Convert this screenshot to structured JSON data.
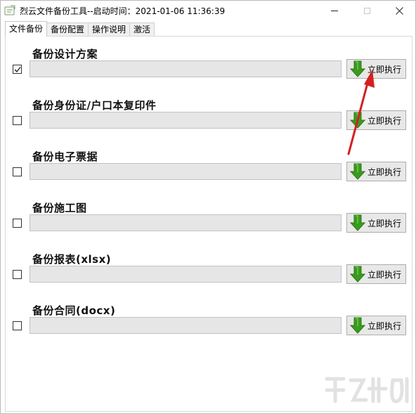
{
  "window": {
    "title": "烈云文件备份工具--启动时间：2021-01-06 11:36:39"
  },
  "tabs": [
    {
      "label": "文件备份",
      "active": true
    },
    {
      "label": "备份配置",
      "active": false
    },
    {
      "label": "操作说明",
      "active": false
    },
    {
      "label": "激活",
      "active": false
    }
  ],
  "rows": [
    {
      "title": "备份设计方案",
      "checked": true,
      "path": "",
      "button": "立即执行"
    },
    {
      "title": "备份身份证/户口本复印件",
      "checked": false,
      "path": "",
      "button": "立即执行"
    },
    {
      "title": "备份电子票据",
      "checked": false,
      "path": "",
      "button": "立即执行"
    },
    {
      "title": "备份施工图",
      "checked": false,
      "path": "",
      "button": "立即执行"
    },
    {
      "title": "备份报表(xlsx)",
      "checked": false,
      "path": "",
      "button": "立即执行"
    },
    {
      "title": "备份合同(docx)",
      "checked": false,
      "path": "",
      "button": "立即执行"
    }
  ],
  "colors": {
    "arrow_green": "#3a9a1e",
    "annotation_red": "#d42020"
  },
  "icons": {
    "run": "green-down-arrow-icon",
    "checkbox": "check-icon"
  }
}
